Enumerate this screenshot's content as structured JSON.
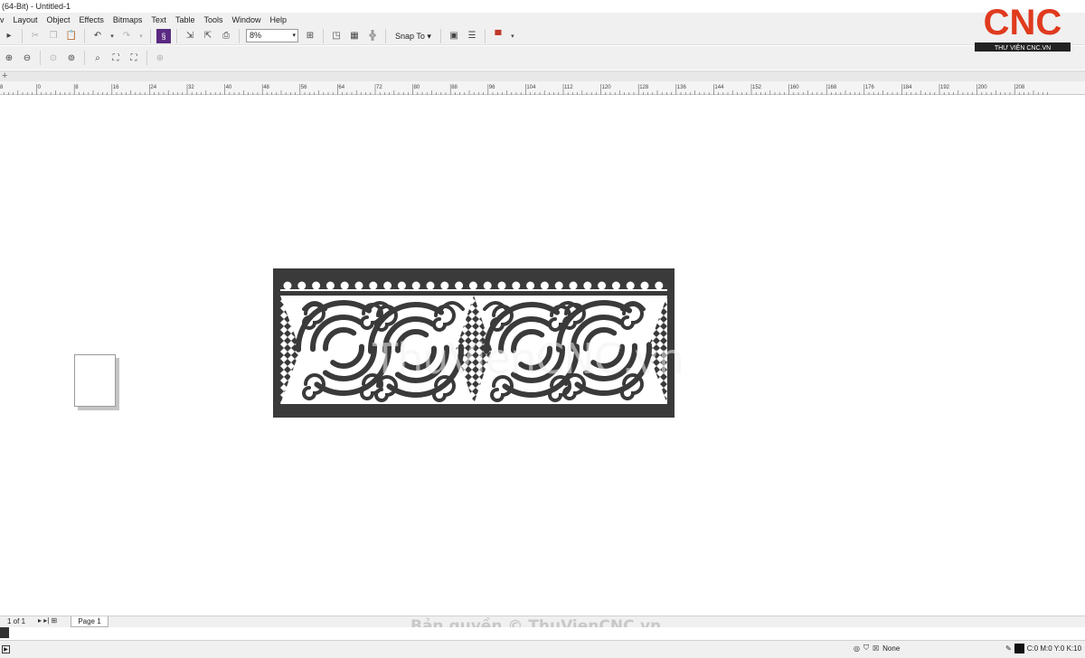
{
  "window": {
    "title": "(64-Bit) - Untitled-1"
  },
  "menu": [
    "v",
    "Layout",
    "Object",
    "Effects",
    "Bitmaps",
    "Text",
    "Table",
    "Tools",
    "Window",
    "Help"
  ],
  "toolbar": {
    "zoom_value": "8%",
    "snap_label": "Snap To"
  },
  "logo": {
    "text": "CNC",
    "subtext": "THƯ VIỆN CNC.VN",
    "accent": "#e03a1e"
  },
  "ruler": {
    "labels": [
      "8",
      "0",
      "8",
      "16",
      "24",
      "32",
      "40",
      "48",
      "56",
      "64",
      "72",
      "80",
      "88",
      "96",
      "104",
      "112",
      "120",
      "128",
      "136",
      "144",
      "152",
      "160",
      "168",
      "176",
      "184",
      "192",
      "200",
      "208"
    ]
  },
  "canvas": {
    "panel_color": "#3a3a3a",
    "watermark": "ThuVienCNC.vn"
  },
  "pages": {
    "count_label": "1 of 1",
    "tab_label": "Page 1"
  },
  "copyright": "Bản quyền © ThuVienCNC.vn",
  "status": {
    "fill_label": "None",
    "color_readout": "C:0 M:0 Y:0 K:10"
  }
}
